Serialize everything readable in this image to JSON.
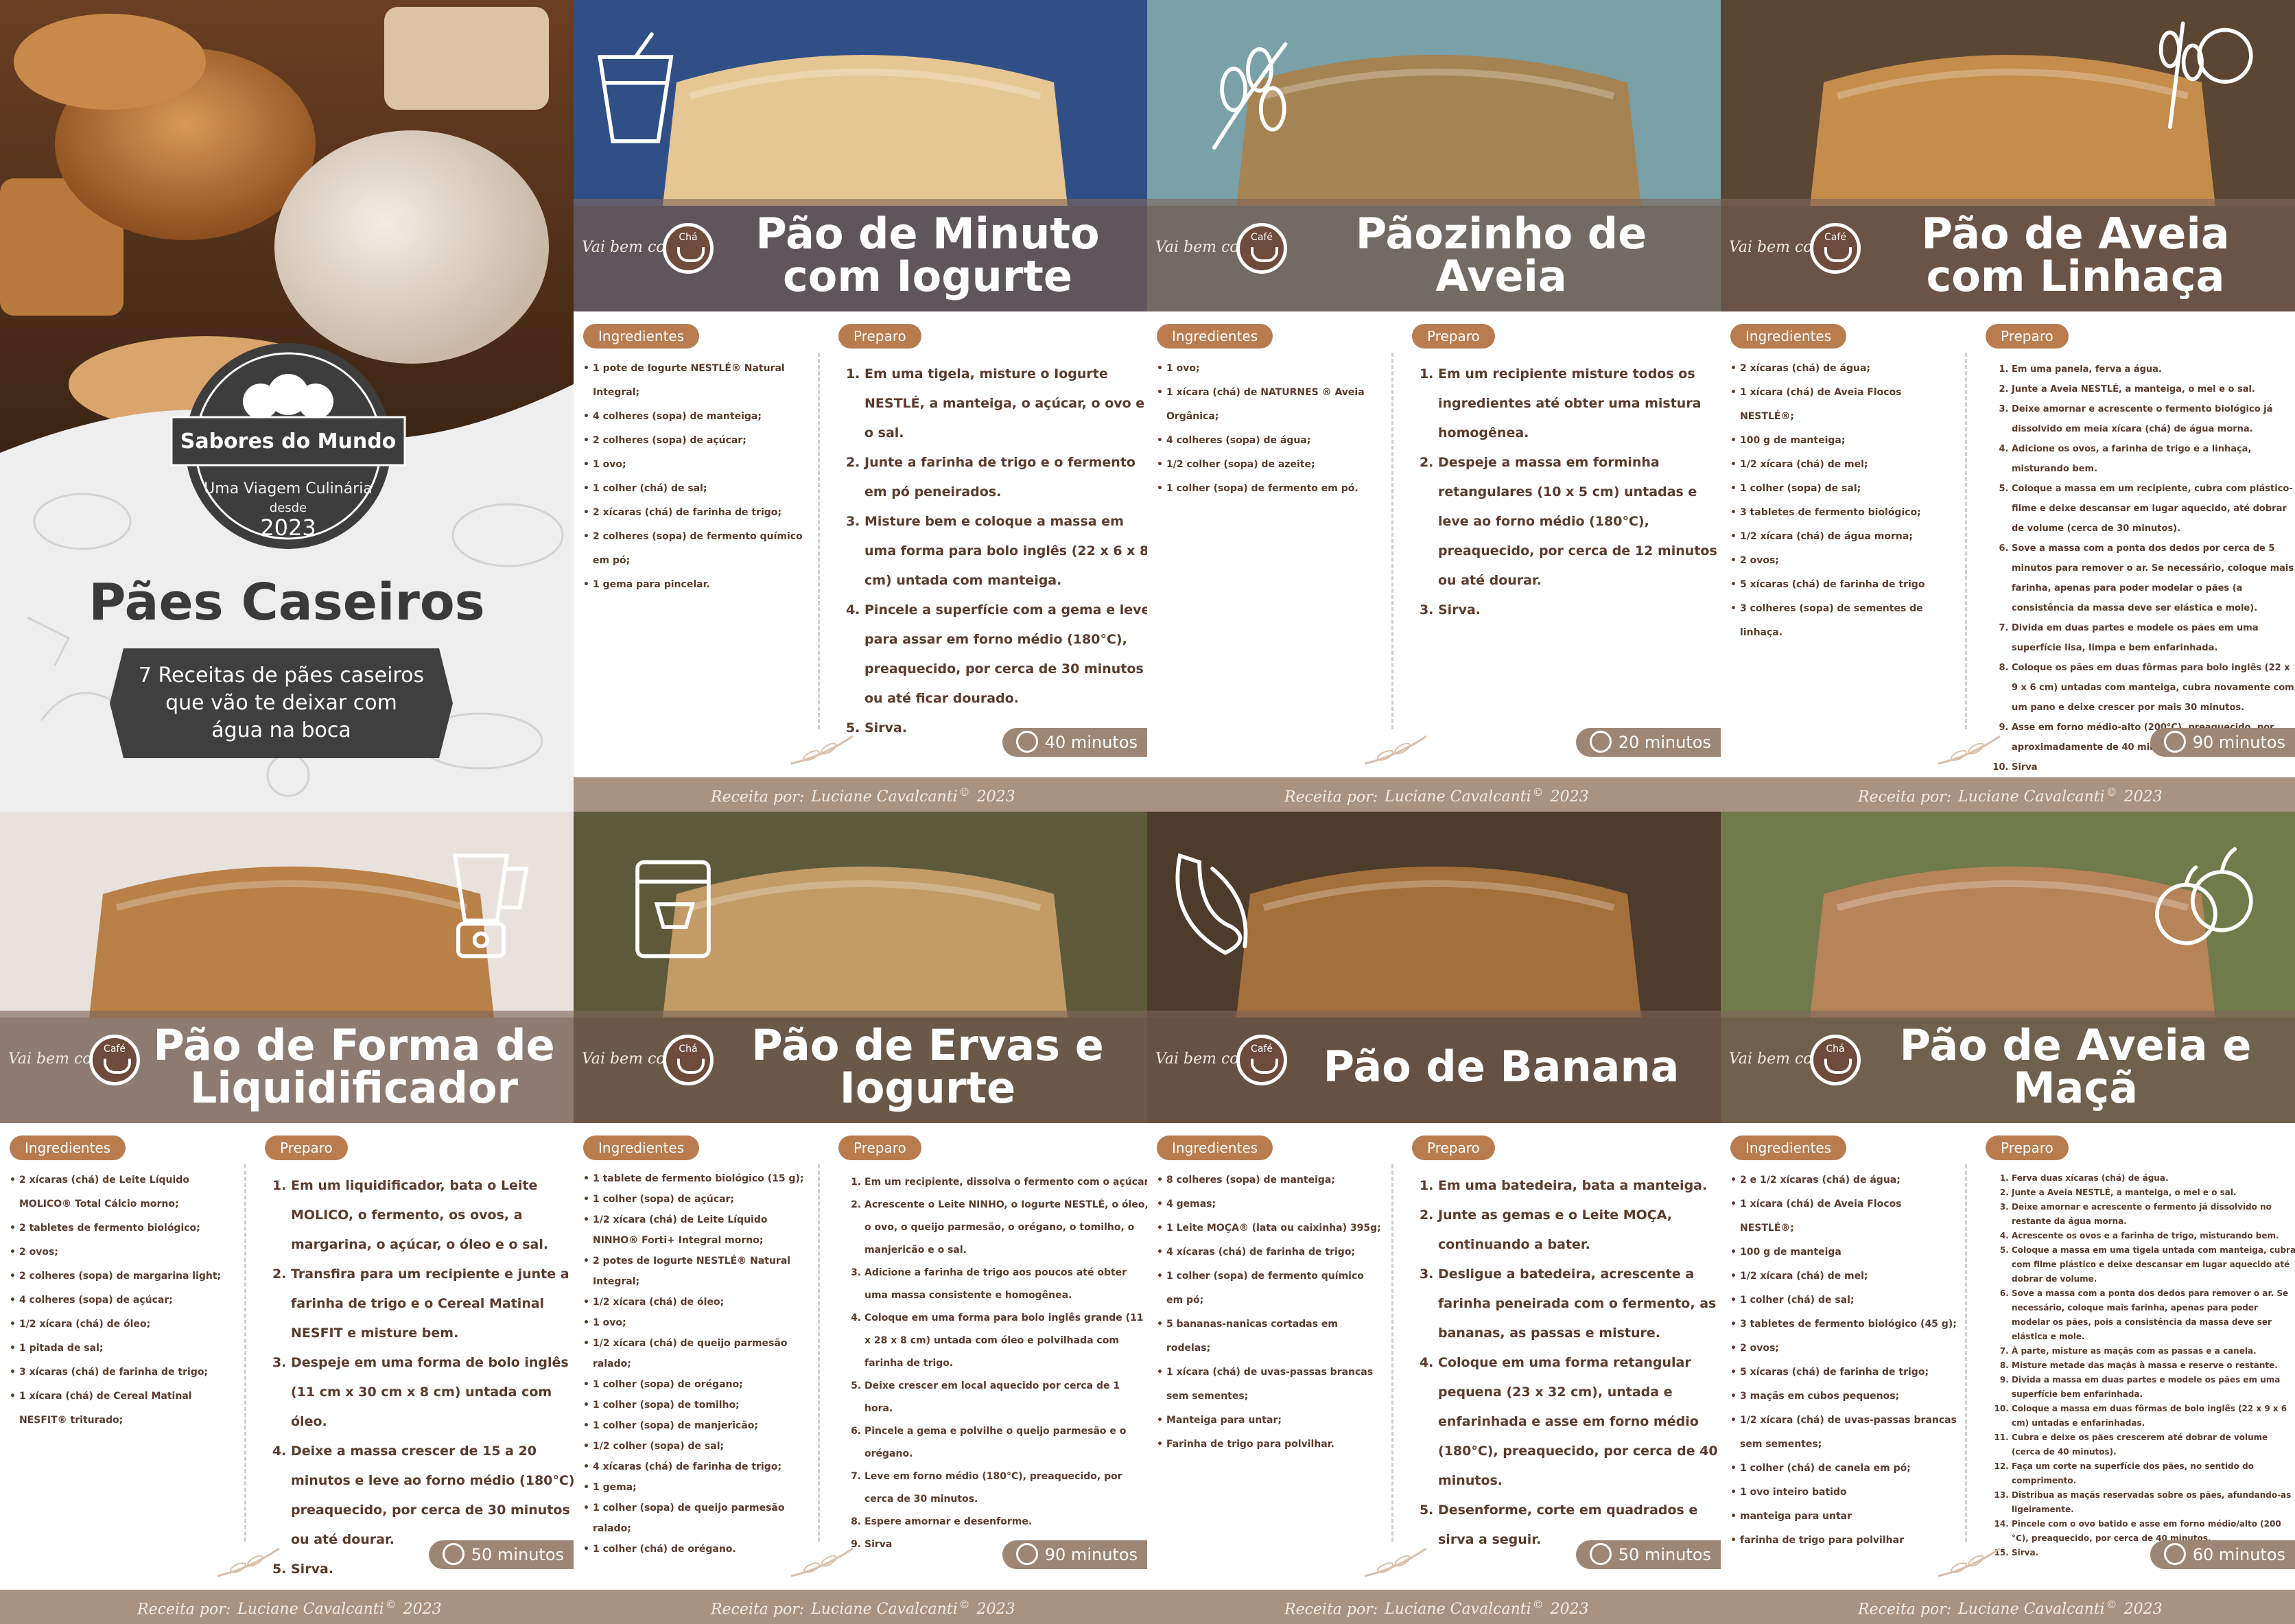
{
  "cover": {
    "brand": "Sabores do Mundo",
    "tagline": "Uma Viagem Culinária",
    "since": "desde",
    "year": "2023",
    "title": "Pães Caseiros",
    "subtitle": "7 Receitas de pães caseiros que vão te deixar com água na boca"
  },
  "labels": {
    "ingredients": "Ingredientes",
    "prep": "Preparo",
    "brand_line": "Vai bem com",
    "credit_prefix": "Receita por:",
    "credit_name": "Luciane Cavalcanti",
    "credit_mark": "©",
    "credit_year": "2023"
  },
  "colors": {
    "accent_brown": "#6e4b3c",
    "pill": "#b87c4f",
    "band": "#7e665a",
    "footer": "#a89383",
    "text_brown": "#5a3b2c"
  },
  "recipes": [
    {
      "title": "Pão de Minuto com Iogurte",
      "pairs_with": "Chá",
      "icon": "yogurt-cup-icon",
      "time": "40 minutos",
      "ingredients": [
        "1 pote de Iogurte NESTLÉ® Natural Integral;",
        "4 colheres (sopa) de manteiga;",
        "2 colheres (sopa) de açúcar;",
        "1 ovo;",
        "1 colher (chá) de sal;",
        "2 xícaras (chá) de farinha de trigo;",
        "2 colheres (sopa) de fermento químico em pó;",
        "1 gema para pincelar."
      ],
      "steps": [
        "Em uma tigela, misture o Iogurte NESTLÉ, a manteiga, o açúcar, o ovo e o sal.",
        "Junte a farinha de trigo e o fermento em pó peneirados.",
        "Misture bem e coloque a massa em uma forma para bolo inglês (22 x 6 x 8 cm) untada com manteiga.",
        "Pincele a superfície com a gema e leve para assar em forno médio (180°C), preaquecido, por cerca de 30 minutos ou até ficar dourado.",
        "Sirva."
      ]
    },
    {
      "title": "Pãozinho de Aveia",
      "pairs_with": "Café",
      "icon": "oat-sprig-icon",
      "time": "20 minutos",
      "ingredients": [
        "1 ovo;",
        "1 xícara (chá) de NATURNES ® Aveia Orgânica;",
        "4 colheres (sopa) de água;",
        "1/2 colher (sopa) de azeite;",
        "1 colher (sopa) de fermento em pó."
      ],
      "steps": [
        "Em um recipiente misture todos os ingredientes até obter uma mistura homogênea.",
        "Despeje a massa em forminha retangulares (10 x 5 cm) untadas e leve ao forno médio (180°C), preaquecido, por cerca de 12 minutos ou até dourar.",
        "Sirva."
      ]
    },
    {
      "title": "Pão de Aveia com Linhaça",
      "pairs_with": "Café",
      "icon": "wheat-seeds-icon",
      "time": "90 minutos",
      "ingredients": [
        "2 xícaras (chá) de água;",
        "1 xícara (chá) de Aveia Flocos NESTLÉ®;",
        "100 g de manteiga;",
        "1/2 xícara (chá) de mel;",
        "1 colher (sopa) de sal;",
        "3 tabletes de fermento biológico;",
        "1/2 xícara (chá) de água morna;",
        "2 ovos;",
        "5 xícaras (chá) de farinha de trigo",
        "3 colheres (sopa) de sementes de linhaça."
      ],
      "steps": [
        "Em uma panela, ferva a água.",
        "Junte a Aveia NESTLÉ, a manteiga, o mel e o sal.",
        "Deixe amornar e acrescente o fermento biológico já dissolvido em meia xícara (chá) de água morna.",
        "Adicione os ovos, a farinha de trigo e a linhaça, misturando bem.",
        "Coloque a massa em um recipiente, cubra com plástico-filme e deixe descansar em lugar aquecido, até dobrar de volume (cerca de 30 minutos).",
        "Sove a massa com a ponta dos dedos por cerca de 5 minutos para remover o ar. Se necessário, coloque mais farinha, apenas para poder modelar o pães (a consistência da massa deve ser elástica e mole).",
        "Divida em duas partes e modele os pães em uma superfície lisa, limpa e bem enfarinhada.",
        "Coloque os pães em duas fôrmas para bolo inglês (22 x 9 x 6 cm) untadas com manteiga, cubra novamente com um pano e deixe crescer por mais 30 minutos.",
        "Asse em forno médio-alto (200°C), preaquecido, por aproximadamente de 40 minutos.",
        "Sirva"
      ]
    },
    {
      "title": "Pão de Forma de Liquidificador",
      "pairs_with": "Café",
      "icon": "blender-icon",
      "time": "50 minutos",
      "ingredients": [
        "2 xícaras (chá) de Leite Líquido MOLICO® Total Cálcio morno;",
        "2 tabletes de fermento biológico;",
        "2 ovos;",
        "2 colheres (sopa) de margarina light;",
        "4 colheres (sopa) de açúcar;",
        "1/2 xícara (chá) de óleo;",
        "1 pitada de sal;",
        "3 xícaras (chá) de farinha de trigo;",
        "1 xícara (chá) de Cereal Matinal NESFIT® triturado;"
      ],
      "steps": [
        "Em um liquidificador, bata o Leite MOLICO, o fermento, os ovos, a margarina, o açúcar, o óleo e o sal.",
        "Transfira para um recipiente e junte a farinha de trigo e o Cereal Matinal NESFIT e misture bem.",
        "Despeje em uma forma de bolo inglês (11 cm x 30 cm x 8 cm) untada com óleo.",
        "Deixe a massa crescer de 15 a 20 minutos e leve ao forno médio (180°C) preaquecido, por cerca de 30 minutos ou até dourar.",
        "Sirva."
      ]
    },
    {
      "title": "Pão de Ervas e Iogurte",
      "pairs_with": "Chá",
      "icon": "yogurt-tub-icon",
      "time": "90 minutos",
      "ingredients": [
        "1 tablete de fermento biológico (15 g);",
        "1 colher (sopa) de açúcar;",
        "1/2 xícara (chá) de Leite Líquido NINHO® Forti+ Integral morno;",
        "2 potes de Iogurte NESTLÉ® Natural Integral;",
        "1/2 xícara (chá) de óleo;",
        "1 ovo;",
        "1/2 xícara (chá) de queijo parmesão ralado;",
        "1 colher (sopa) de orégano;",
        "1 colher (sopa) de tomilho;",
        "1 colher (sopa) de manjericão;",
        "1/2 colher (sopa) de sal;",
        "4 xícaras (chá) de farinha de trigo;",
        "1 gema;",
        "1 colher (sopa) de queijo parmesão ralado;",
        "1 colher (chá) de orégano."
      ],
      "steps": [
        "Em um recipiente, dissolva o fermento com o açúcar.",
        "Acrescente o Leite NINHO, o Iogurte NESTLÉ, o óleo, o ovo, o queijo parmesão, o orégano, o tomilho, o manjericão e o sal.",
        "Adicione a farinha de trigo aos poucos até obter uma massa consistente e homogênea.",
        "Coloque em uma forma para bolo inglês grande (11 x 28 x 8 cm) untada com óleo e polvilhada com farinha de trigo.",
        "Deixe crescer em local aquecido por cerca de 1 hora.",
        "Pincele a gema e polvilhe o queijo parmesão e o orégano.",
        "Leve em forno médio (180°C), preaquecido, por cerca de 30 minutos.",
        "Espere amornar e desenforme.",
        "Sirva"
      ]
    },
    {
      "title": "Pão de Banana",
      "pairs_with": "Café",
      "icon": "banana-icon",
      "time": "50 minutos",
      "ingredients": [
        "8 colheres (sopa) de manteiga;",
        "4 gemas;",
        "1 Leite MOÇA® (lata ou caixinha) 395g;",
        "4 xícaras (chá) de farinha de trigo;",
        "1 colher (sopa) de fermento químico em pó;",
        "5 bananas-nanicas cortadas em rodelas;",
        "1 xícara (chá) de uvas-passas brancas sem sementes;",
        "Manteiga para untar;",
        "Farinha de trigo para polvilhar."
      ],
      "steps": [
        "Em uma batedeira, bata a manteiga.",
        "Junte as gemas e o Leite MOÇA, continuando a bater.",
        "Desligue a batedeira, acrescente a farinha peneirada com o fermento, as bananas, as passas e misture.",
        "Coloque em uma forma retangular pequena (23 x 32 cm), untada e enfarinhada e asse em forno médio (180°C), preaquecido, por cerca de 40 minutos.",
        "Desenforme, corte em quadrados e sirva a seguir."
      ]
    },
    {
      "title": "Pão de Aveia e Maçã",
      "pairs_with": "Chá",
      "icon": "apples-icon",
      "time": "60 minutos",
      "ingredients": [
        "2 e 1/2 xícaras (chá) de água;",
        "1 xícara (chá) de Aveia Flocos NESTLÉ®;",
        "100 g de manteiga",
        "1/2 xícara (chá) de mel;",
        "1 colher (chá) de sal;",
        "3 tabletes de fermento biológico (45 g);",
        "2 ovos;",
        "5 xícaras (chá) de farinha de trigo;",
        "3 maçãs em cubos pequenos;",
        "1/2 xícara (chá) de uvas-passas brancas sem sementes;",
        "1 colher (chá) de canela em pó;",
        "1 ovo inteiro batido",
        "manteiga para untar",
        "farinha de trigo para polvilhar"
      ],
      "steps": [
        "Ferva duas xícaras (chá) de água.",
        "Junte a Aveia NESTLÉ, a manteiga, o mel e o sal.",
        "Deixe amornar e acrescente o fermento já dissolvido no restante da água morna.",
        "Acrescente os ovos e a farinha de trigo, misturando bem.",
        "Coloque a massa em uma tigela untada com manteiga, cubra com filme plástico e deixe descansar em lugar aquecido até dobrar de volume.",
        "Sove a massa com a ponta dos dedos para remover o ar. Se necessário, coloque mais farinha, apenas para poder modelar os pães, pois a consistência da massa deve ser elástica e mole.",
        "À parte, misture as maçãs com as passas e a canela.",
        "Misture metade das maçãs à massa e reserve o restante.",
        "Divida a massa em duas partes e modele os pães em uma superfície bem enfarinhada.",
        "Coloque a massa em duas fôrmas de bolo inglês (22 x 9 x 6 cm) untadas e enfarinhadas.",
        "Cubra e deixe os pães crescerem até dobrar de volume (cerca de 40 minutos).",
        "Faça um corte na superfície dos pães, no sentido do comprimento.",
        "Distribua as maçãs reservadas sobre os pães, afundando-as ligeiramente.",
        "Pincele com o ovo batido e asse em forno médio/alto (200 °C), preaquecido, por cerca de 40 minutos.",
        "Sirva."
      ]
    }
  ]
}
